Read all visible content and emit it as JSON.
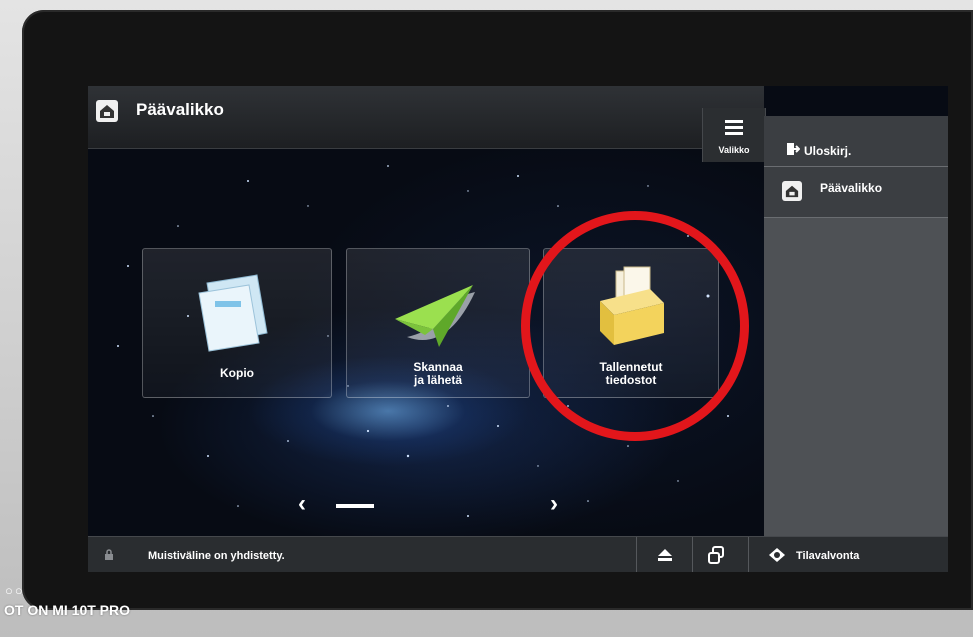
{
  "header": {
    "title": "Päävalikko",
    "menu_label": "Valikko"
  },
  "sidebar": {
    "logout_label": "Uloskirj.",
    "home_label": "Päävalikko"
  },
  "tiles": [
    {
      "line1": "Kopio",
      "line2": ""
    },
    {
      "line1": "Skannaa",
      "line2": "ja lähetä"
    },
    {
      "line1": "Tallennetut",
      "line2": "tiedostot"
    }
  ],
  "status": {
    "message": "Muistiväline on yhdistetty.",
    "status_monitor": "Tilavalvonta"
  },
  "overlay": {
    "annotation_color": "#e2161b"
  },
  "photo": {
    "watermark": "OT ON MI 10T PRO",
    "dots": "○○"
  },
  "icons": [
    "home-icon",
    "menu-icon",
    "logout-icon",
    "copy-icon",
    "send-icon",
    "stored-files-icon",
    "lock-icon",
    "eject-icon",
    "switch-icon",
    "status-monitor-icon",
    "chevron-left-icon",
    "chevron-right-icon"
  ]
}
